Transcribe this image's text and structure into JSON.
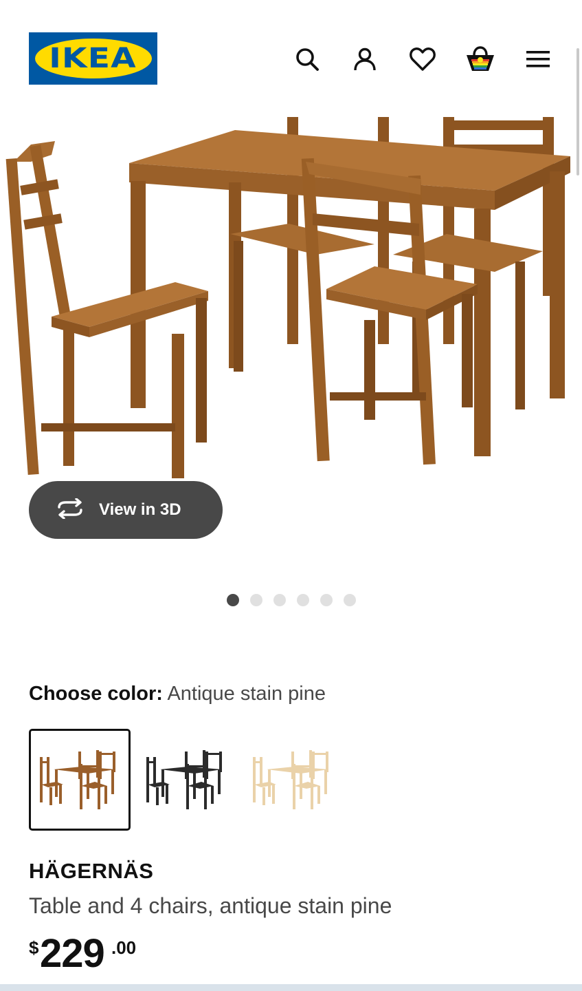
{
  "brand": {
    "logo_text": "IKEA",
    "blue": "#0058a3",
    "yellow": "#ffdb00"
  },
  "header": {
    "icons": [
      "search-icon",
      "account-icon",
      "heart-icon",
      "cart-icon",
      "menu-icon"
    ]
  },
  "gallery": {
    "view_3d_label": "View in 3D",
    "image_count": 6,
    "active_index": 0
  },
  "color_picker": {
    "label": "Choose color:",
    "selected": "Antique stain pine",
    "swatches": [
      {
        "name": "antique-stain-pine",
        "color": "#9a5f2b",
        "selected": true
      },
      {
        "name": "black",
        "color": "#2b2b2b",
        "selected": false
      },
      {
        "name": "natural-pine",
        "color": "#ead2a9",
        "selected": false
      }
    ]
  },
  "product": {
    "name": "HÄGERNÄS",
    "description": "Table and 4 chairs, antique stain pine",
    "price": {
      "currency": "$",
      "integer": "229",
      "decimal": ".00"
    }
  }
}
